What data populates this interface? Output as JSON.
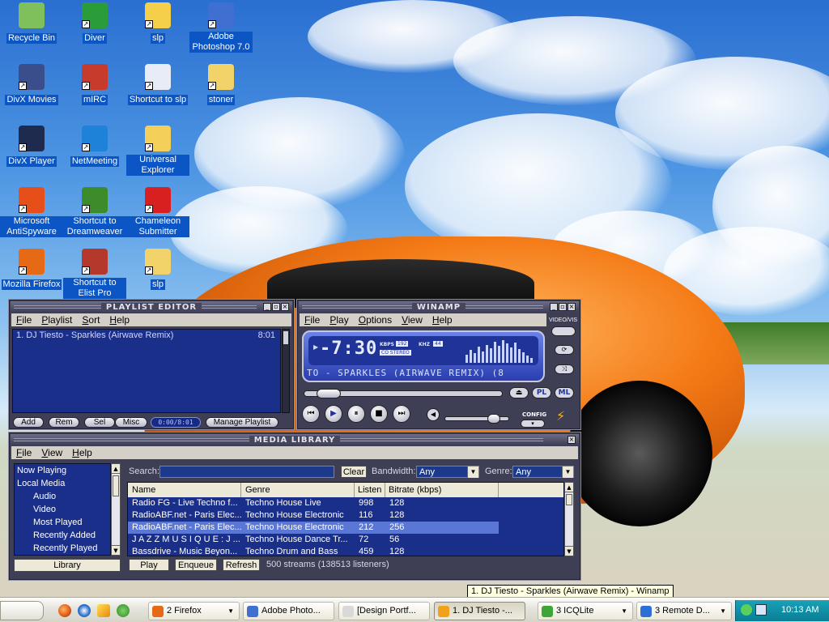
{
  "desktop": {
    "icons": [
      {
        "label": "Recycle Bin",
        "icon": "recycle-bin-icon"
      },
      {
        "label": "Diver",
        "icon": "checkmark-icon"
      },
      {
        "label": "slp",
        "icon": "folder-icon"
      },
      {
        "label": "Adobe Photoshop 7.0",
        "icon": "photoshop-icon"
      },
      {
        "label": "DivX Movies",
        "icon": "divx-folder-icon"
      },
      {
        "label": "mIRC",
        "icon": "mirc-icon"
      },
      {
        "label": "Shortcut to slp",
        "icon": "document-shortcut-icon"
      },
      {
        "label": "stoner",
        "icon": "zip-folder-icon"
      },
      {
        "label": "DivX Player",
        "icon": "divx-player-icon"
      },
      {
        "label": "NetMeeting",
        "icon": "netmeeting-icon"
      },
      {
        "label": "Universal Explorer",
        "icon": "eye-icon"
      },
      {
        "label": "Microsoft AntiSpyware",
        "icon": "antispyware-icon"
      },
      {
        "label": "Shortcut to Dreamweaver",
        "icon": "dreamweaver-icon"
      },
      {
        "label": "Chameleon Submitter",
        "icon": "chameleon-icon"
      },
      {
        "label": "Mozilla Firefox",
        "icon": "firefox-icon"
      },
      {
        "label": "Shortcut to Elist Pro",
        "icon": "elist-icon"
      },
      {
        "label": "slp",
        "icon": "zip-folder-icon"
      }
    ]
  },
  "playlist_editor": {
    "title": "PLAYLIST EDITOR",
    "menu": [
      "File",
      "Playlist",
      "Sort",
      "Help"
    ],
    "items": [
      {
        "title": "1. DJ Tiesto - Sparkles (Airwave Remix)",
        "time": "8:01"
      }
    ],
    "buttons": [
      "Add",
      "Rem",
      "Sel",
      "Misc"
    ],
    "position": "0:00/8:01",
    "manage_label": "Manage Playlist"
  },
  "player": {
    "title": "WINAMP",
    "menu": [
      "File",
      "Play",
      "Options",
      "View",
      "Help"
    ],
    "time": "-7:30",
    "kbps_label": "KBPS",
    "kbps": "192",
    "khz_label": "KHZ",
    "khz": "44",
    "mode": "CO STEREO",
    "marquee": "TO - SPARKLES (AIRWAVE REMIX) (8",
    "videovis": "VIDEO/VIS",
    "pl": "PL",
    "ml": "ML",
    "config": "CONFIG",
    "seek_fraction": 0.06,
    "volume_fraction": 0.85
  },
  "media_library": {
    "title": "MEDIA LIBRARY",
    "menu": [
      "File",
      "View",
      "Help"
    ],
    "tree": [
      {
        "label": "Now Playing",
        "indent": 0
      },
      {
        "label": "Local Media",
        "indent": 0
      },
      {
        "label": "Audio",
        "indent": 1
      },
      {
        "label": "Video",
        "indent": 1
      },
      {
        "label": "Most Played",
        "indent": 1
      },
      {
        "label": "Recently Added",
        "indent": 1
      },
      {
        "label": "Recently Played",
        "indent": 1
      }
    ],
    "library_button": "Library",
    "search_label": "Search:",
    "search_value": "",
    "clear_label": "Clear",
    "bandwidth_label": "Bandwidth:",
    "bandwidth_value": "Any",
    "genre_label": "Genre:",
    "genre_value": "Any",
    "columns": [
      "Name",
      "Genre",
      "Listen",
      "Bitrate (kbps)"
    ],
    "rows": [
      {
        "name": "Radio FG - Live Techno f...",
        "genre": "Techno House Live",
        "listen": "998",
        "bitrate": "128",
        "selected": false
      },
      {
        "name": "RadioABF.net - Paris Elec...",
        "genre": "Techno House Electronic",
        "listen": "116",
        "bitrate": "128",
        "selected": false
      },
      {
        "name": "RadioABF.net - Paris Elec...",
        "genre": "Techno House Electronic",
        "listen": "212",
        "bitrate": "256",
        "selected": true
      },
      {
        "name": "J A Z Z M U S I Q U E : J ...",
        "genre": "Techno House Dance Tr...",
        "listen": "72",
        "bitrate": "56",
        "selected": false
      },
      {
        "name": "Bassdrive - Music Beyon...",
        "genre": "Techno Drum and Bass",
        "listen": "459",
        "bitrate": "128",
        "selected": false
      }
    ],
    "play_label": "Play",
    "enqueue_label": "Enqueue",
    "refresh_label": "Refresh",
    "status": "500 streams (138513 listeners)"
  },
  "tooltip": "1. DJ Tiesto - Sparkles (Airwave Remix) - Winamp",
  "taskbar": {
    "tasks": [
      {
        "label": "2 Firefox",
        "icon": "firefox-icon",
        "grouped": true,
        "active": false
      },
      {
        "label": "Adobe Photo...",
        "icon": "photoshop-icon",
        "grouped": false,
        "active": false
      },
      {
        "label": "[Design Portf...",
        "icon": "document-icon",
        "grouped": false,
        "active": false
      },
      {
        "label": "1. DJ Tiesto -...",
        "icon": "winamp-icon",
        "grouped": false,
        "active": true
      },
      {
        "label": "3 ICQLite",
        "icon": "icq-icon",
        "grouped": true,
        "active": false
      },
      {
        "label": "3 Remote D...",
        "icon": "remote-desktop-icon",
        "grouped": true,
        "active": false
      }
    ],
    "clock": "10:13 AM"
  }
}
